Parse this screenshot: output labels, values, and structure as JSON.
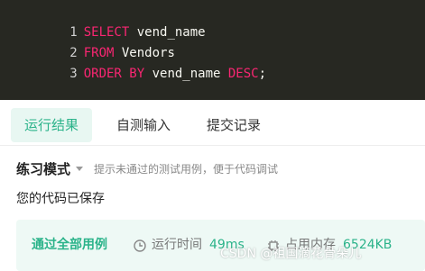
{
  "editor": {
    "lines": [
      {
        "num": "1",
        "tokens": [
          {
            "t": "SELECT",
            "k": "kw"
          },
          {
            "t": " vend_name",
            "k": "id"
          }
        ]
      },
      {
        "num": "2",
        "tokens": [
          {
            "t": "FROM",
            "k": "kw"
          },
          {
            "t": " Vendors",
            "k": "id"
          }
        ]
      },
      {
        "num": "3",
        "tokens": [
          {
            "t": "ORDER BY",
            "k": "kw"
          },
          {
            "t": " vend_name ",
            "k": "id"
          },
          {
            "t": "DESC",
            "k": "kw"
          },
          {
            "t": ";",
            "k": "id"
          }
        ]
      }
    ]
  },
  "tabs": {
    "run_result": "运行结果",
    "self_test": "自测输入",
    "submit_record": "提交记录"
  },
  "mode": {
    "label": "练习模式",
    "hint": "提示未通过的测试用例，便于代码调试"
  },
  "saved_message": "您的代码已保存",
  "result": {
    "status": "通过全部用例",
    "runtime_label": "运行时间",
    "runtime_value": "49ms",
    "memory_label": "占用内存",
    "memory_value": "6524KB"
  },
  "watermark": "CSDN @祖国滴花骨朵儿",
  "colors": {
    "editor_bg": "#272822",
    "keyword": "#f92672",
    "identifier": "#f8f8f2",
    "accent": "#2bb38a"
  }
}
